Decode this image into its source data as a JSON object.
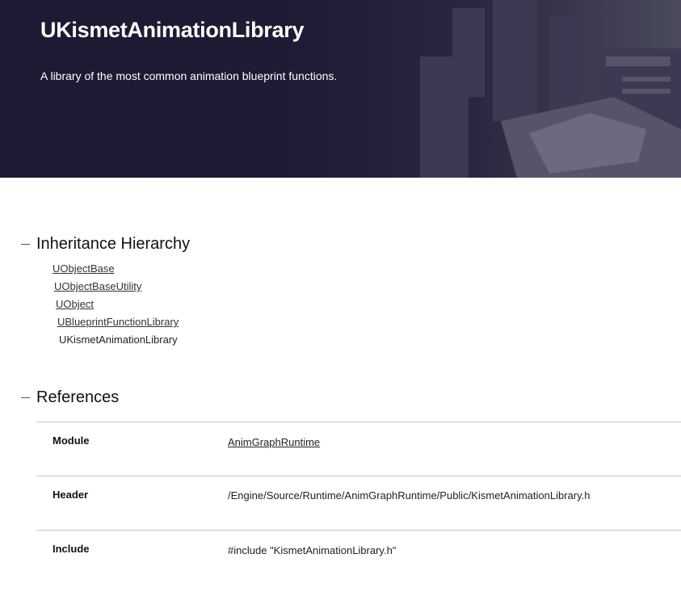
{
  "header": {
    "title": "UKismetAnimationLibrary",
    "description": "A library of the most common animation blueprint functions."
  },
  "inheritance": {
    "heading": "Inheritance Hierarchy",
    "items": [
      {
        "label": "UObjectBase",
        "link": true
      },
      {
        "label": "UObjectBaseUtility",
        "link": true
      },
      {
        "label": "UObject",
        "link": true
      },
      {
        "label": "UBlueprintFunctionLibrary",
        "link": true
      },
      {
        "label": "UKismetAnimationLibrary",
        "link": false
      }
    ]
  },
  "references": {
    "heading": "References",
    "rows": [
      {
        "key": "Module",
        "value": "AnimGraphRuntime",
        "link": true
      },
      {
        "key": "Header",
        "value": "/Engine/Source/Runtime/AnimGraphRuntime/Public/KismetAnimationLibrary.h",
        "link": false
      },
      {
        "key": "Include",
        "value": "#include \"KismetAnimationLibrary.h\"",
        "link": false
      }
    ]
  },
  "colors": {
    "hero_bg": "#1d1a33",
    "hero_text": "#ffffff",
    "divider": "#c8c8c8"
  }
}
